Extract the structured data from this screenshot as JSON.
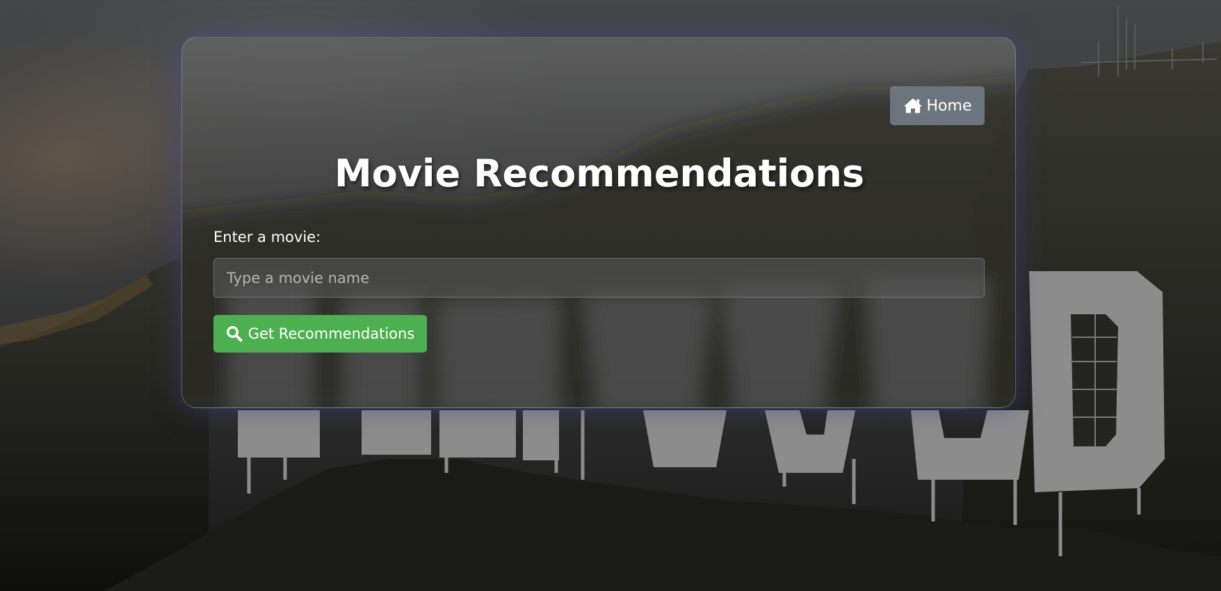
{
  "header": {
    "home_label": "Home",
    "home_icon": "home-icon"
  },
  "main": {
    "title": "Movie Recommendations",
    "field_label": "Enter a movie:",
    "input_value": "",
    "input_placeholder": "Type a movie name",
    "submit_label": "Get Recommendations",
    "submit_icon": "search-icon"
  },
  "colors": {
    "home_button": "#6c757d",
    "submit_button": "#4caf50",
    "text": "#ffffff",
    "card_glow": "#4646a0"
  }
}
